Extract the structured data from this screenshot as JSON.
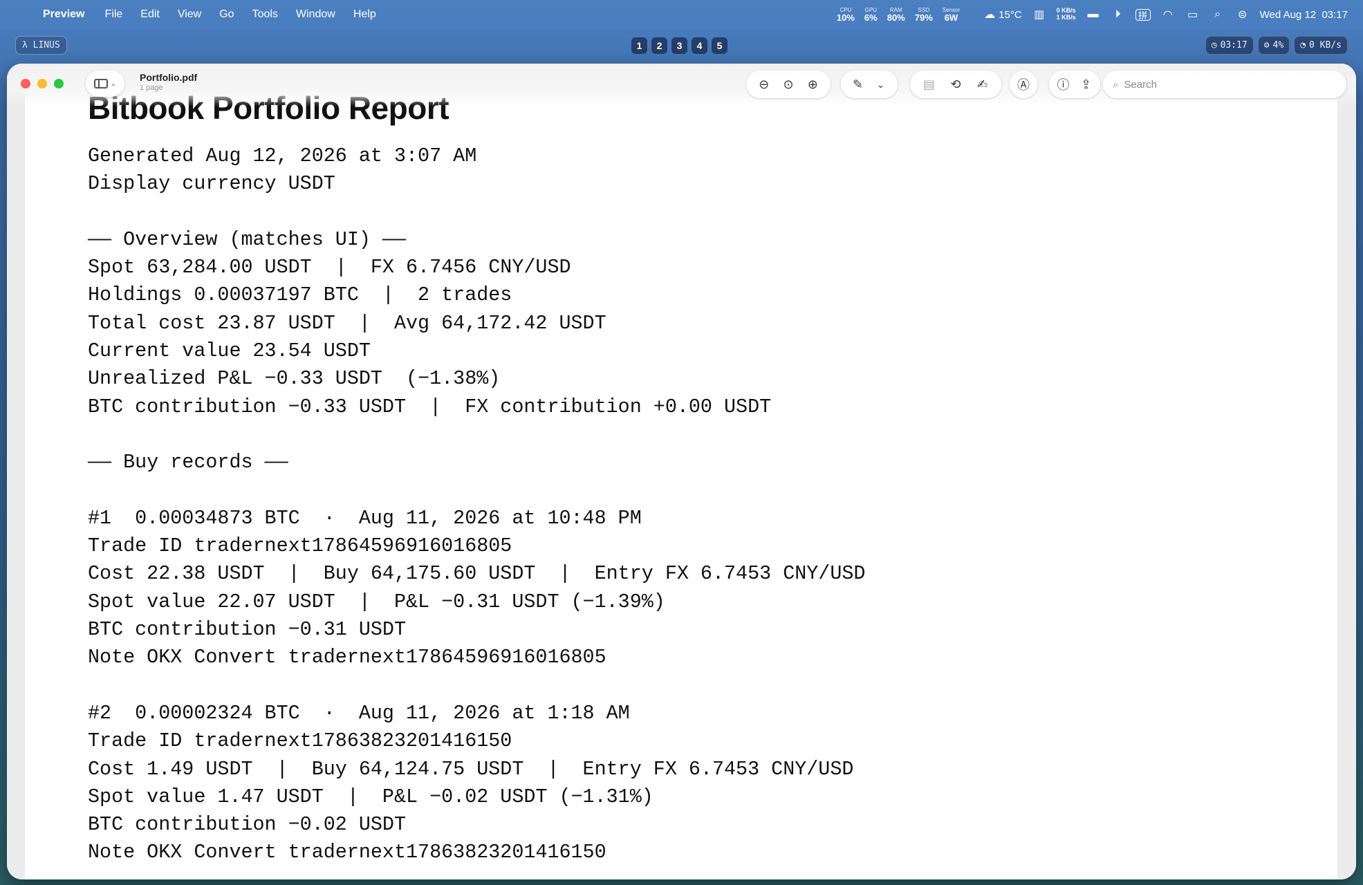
{
  "menubar": {
    "app_name": "Preview",
    "menus": [
      "File",
      "Edit",
      "View",
      "Go",
      "Tools",
      "Window",
      "Help"
    ],
    "stats": [
      {
        "cap": "CPU",
        "val": "10%"
      },
      {
        "cap": "GPU",
        "val": "6%"
      },
      {
        "cap": "RAM",
        "val": "80%"
      },
      {
        "cap": "SSD",
        "val": "79%"
      },
      {
        "cap": "Sensor",
        "val": "6W"
      }
    ],
    "weather": "15°C",
    "net_up": "0 KB/s",
    "net_down": "1 KB/s",
    "input_method": "拼",
    "datetime": "Wed Aug 12  03:17"
  },
  "subbar": {
    "linus": "λ LINUS",
    "spaces": [
      "1",
      "2",
      "3",
      "4",
      "5"
    ],
    "clock": "03:17",
    "cpu": "4%",
    "net": "0 KB/s"
  },
  "window": {
    "title": "Portfolio.pdf",
    "subtitle": "1 page",
    "search_placeholder": "Search"
  },
  "document": {
    "title": "Bitbook Portfolio Report",
    "header_lines": [
      "Generated Aug 12, 2026 at 3:07 AM",
      "Display currency USDT"
    ],
    "overview_heading": "—— Overview (matches UI) ——",
    "overview_lines": [
      "Spot 63,284.00 USDT  |  FX 6.7456 CNY/USD",
      "Holdings 0.00037197 BTC  |  2 trades",
      "Total cost 23.87 USDT  |  Avg 64,172.42 USDT",
      "Current value 23.54 USDT",
      "Unrealized P&L −0.33 USDT  (−1.38%)",
      "BTC contribution −0.33 USDT  |  FX contribution +0.00 USDT"
    ],
    "buy_heading": "—— Buy records ——",
    "records": [
      {
        "lines": [
          "#1  0.00034873 BTC  ·  Aug 11, 2026 at 10:48 PM",
          "Trade ID tradernext17864596916016805",
          "Cost 22.38 USDT  |  Buy 64,175.60 USDT  |  Entry FX 6.7453 CNY/USD",
          "Spot value 22.07 USDT  |  P&L −0.31 USDT (−1.39%)",
          "BTC contribution −0.31 USDT",
          "Note OKX Convert tradernext17864596916016805"
        ]
      },
      {
        "lines": [
          "#2  0.00002324 BTC  ·  Aug 11, 2026 at 1:18 AM",
          "Trade ID tradernext17863823201416150",
          "Cost 1.49 USDT  |  Buy 64,124.75 USDT  |  Entry FX 6.7453 CNY/USD",
          "Spot value 1.47 USDT  |  P&L −0.02 USDT (−1.31%)",
          "BTC contribution −0.02 USDT",
          "Note OKX Convert tradernext17863823201416150"
        ]
      }
    ]
  }
}
